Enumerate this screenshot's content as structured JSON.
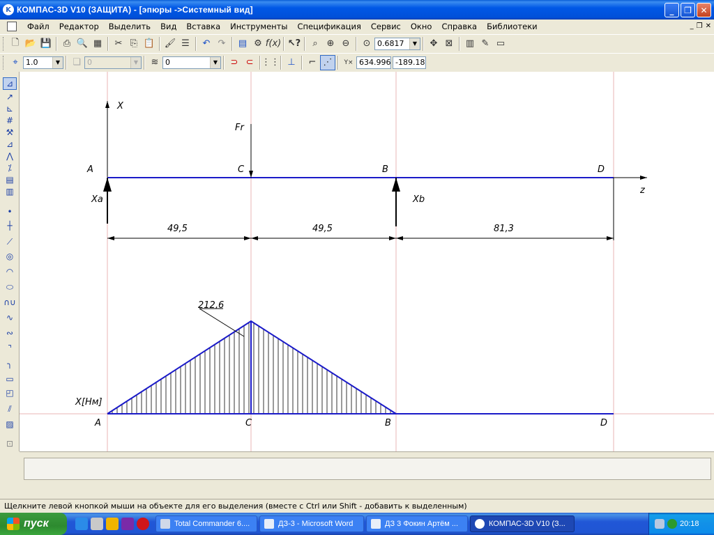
{
  "window": {
    "title": "КОМПАС-3D V10 (ЗАЩИТА) - [эпюры ->Системный вид]",
    "minimize": "_",
    "maximize": "❐",
    "close": "✕"
  },
  "menu": {
    "items": [
      "Файл",
      "Редактор",
      "Выделить",
      "Вид",
      "Вставка",
      "Инструменты",
      "Спецификация",
      "Сервис",
      "Окно",
      "Справка",
      "Библиотеки"
    ]
  },
  "toolbar1": {
    "zoom_value": "0.6817"
  },
  "toolbar2": {
    "scale_value": "1.0",
    "layer_disabled_value": "0",
    "layer_value": "0",
    "coord_label": "Y×",
    "coord_x": "634.996",
    "coord_y": "-189.18"
  },
  "drawing": {
    "top_labels": {
      "x_axis": "X",
      "force": "Fr",
      "A": "A",
      "C": "C",
      "B": "B",
      "D": "D",
      "z_axis": "z",
      "Xa": "Xa",
      "Xb": "Xb"
    },
    "dimensions": [
      "49,5",
      "49,5",
      "81,3"
    ],
    "moment_diagram": {
      "peak_value": "212,6",
      "axis_label": "X[Нм]",
      "A": "A",
      "C": "C",
      "B": "B",
      "D": "D"
    }
  },
  "status": {
    "hint": "Щелкните левой кнопкой мыши на объекте для его выделения (вместе с Ctrl или Shift - добавить к выделенным)"
  },
  "taskbar": {
    "start": "пуск",
    "tasks": [
      "Total Commander 6....",
      "ДЗ-3 - Microsoft Word",
      "ДЗ 3 Фокин Артём ...",
      "КОМПАС-3D V10 (З..."
    ],
    "clock": "20:18"
  }
}
